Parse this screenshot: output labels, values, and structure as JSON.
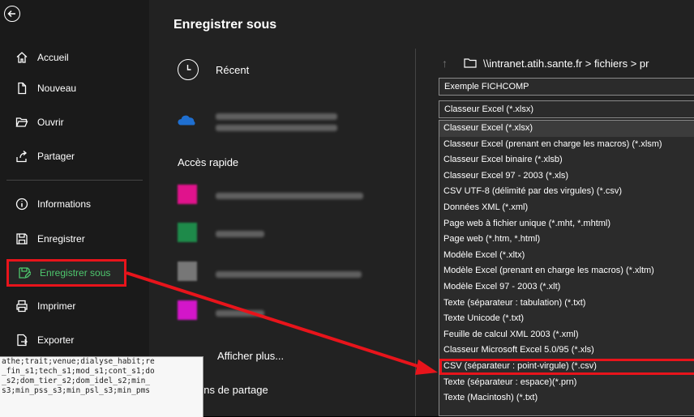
{
  "nav": {
    "items": [
      {
        "label": "Accueil",
        "icon": "home-icon"
      },
      {
        "label": "Nouveau",
        "icon": "new-document-icon"
      },
      {
        "label": "Ouvrir",
        "icon": "open-folder-icon"
      },
      {
        "label": "Partager",
        "icon": "share-icon"
      },
      {
        "label": "Informations",
        "icon": "info-icon"
      },
      {
        "label": "Enregistrer",
        "icon": "save-icon"
      },
      {
        "label": "Enregistrer sous",
        "icon": "save-as-icon"
      },
      {
        "label": "Imprimer",
        "icon": "print-icon"
      },
      {
        "label": "Exporter",
        "icon": "export-icon"
      }
    ]
  },
  "main": {
    "title": "Enregistrer sous",
    "recent_label": "Récent",
    "quick_access_label": "Accès rapide",
    "show_more_label": "Afficher plus...",
    "partage_label": "ons de partage"
  },
  "location": {
    "path": "\\\\intranet.atih.sante.fr > fichiers > pr"
  },
  "filename": {
    "value": "Exemple FICHCOMP"
  },
  "filetype": {
    "selected": "Classeur Excel (*.xlsx)",
    "options": [
      "Classeur Excel (*.xlsx)",
      "Classeur Excel (prenant en charge les macros) (*.xlsm)",
      "Classeur Excel binaire (*.xlsb)",
      "Classeur Excel 97 - 2003 (*.xls)",
      "CSV UTF-8 (délimité par des virgules) (*.csv)",
      "Données XML (*.xml)",
      "Page web à fichier unique (*.mht, *.mhtml)",
      "Page web (*.htm, *.html)",
      "Modèle Excel (*.xltx)",
      "Modèle Excel (prenant en charge les macros) (*.xltm)",
      "Modèle Excel 97 - 2003 (*.xlt)",
      "Texte (séparateur : tabulation) (*.txt)",
      "Texte Unicode (*.txt)",
      "Feuille de calcul XML 2003 (*.xml)",
      "Classeur Microsoft Excel 5.0/95 (*.xls)",
      "CSV (séparateur : point-virgule) (*.csv)",
      "Texte (séparateur : espace)(*.prn)",
      "Texte (Macintosh) (*.txt)"
    ]
  },
  "notepad": {
    "lines": [
      "athe;trait;venue;dialyse_habit;re",
      "_fin_s1;tech_s1;mod_s1;cont_s1;do",
      "_s2;dom_tier_s2;dom_idel_s2;min_",
      "s3;min_pss_s3;min_psl_s3;min_pms"
    ]
  },
  "colors": {
    "highlight": "#e8141b",
    "active_text": "#4ec86e",
    "heading_link": "#2f58c8"
  }
}
